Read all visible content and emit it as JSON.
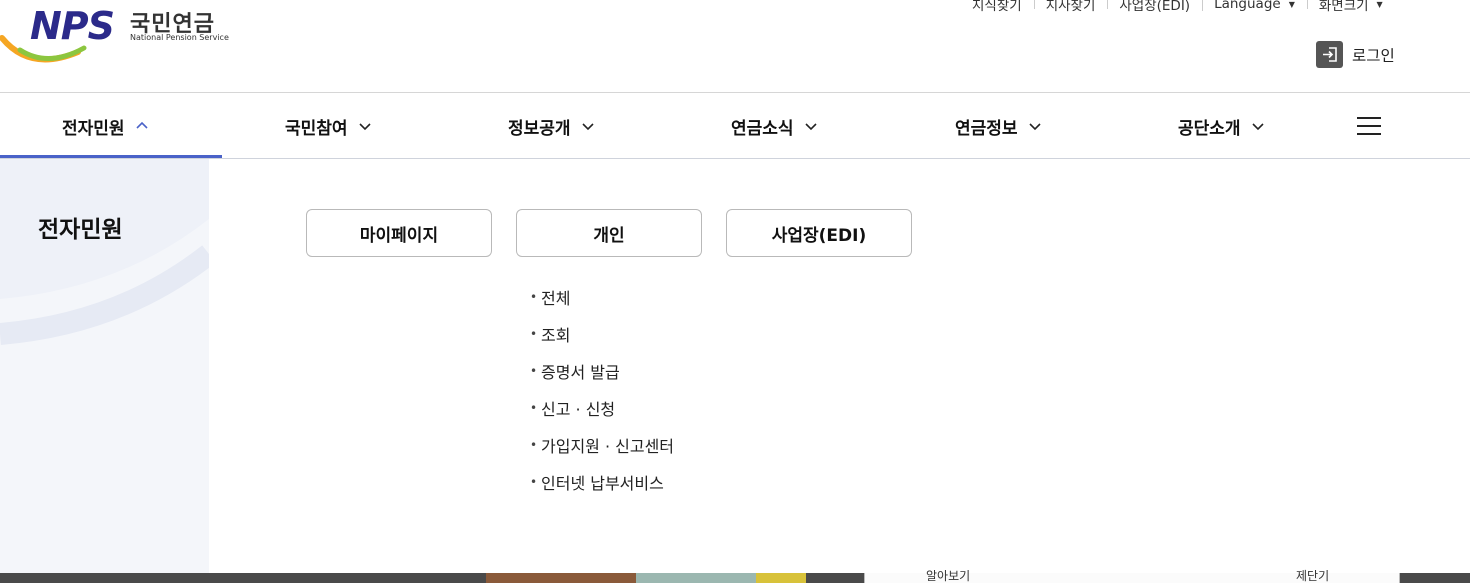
{
  "logo": {
    "mark": "NPS",
    "name_ko": "국민연금",
    "name_en": "National Pension Service"
  },
  "utility": [
    {
      "label": "지식찾기",
      "caret": false
    },
    {
      "label": "지사찾기",
      "caret": false
    },
    {
      "label": "사업장(EDI)",
      "caret": false
    },
    {
      "label": "Language",
      "caret": true
    },
    {
      "label": "화면크기",
      "caret": true
    }
  ],
  "login": {
    "label": "로그인",
    "icon": "login-icon"
  },
  "gnb": [
    {
      "label": "전자민원",
      "active": true
    },
    {
      "label": "국민참여",
      "active": false
    },
    {
      "label": "정보공개",
      "active": false
    },
    {
      "label": "연금소식",
      "active": false
    },
    {
      "label": "연금정보",
      "active": false
    },
    {
      "label": "공단소개",
      "active": false
    }
  ],
  "menu_icon": "hamburger-menu-icon",
  "panel": {
    "title": "전자민원",
    "categories": [
      "마이페이지",
      "개인",
      "사업장(EDI)"
    ],
    "submenu": [
      "전체",
      "조회",
      "증명서 발급",
      "신고 · 신청",
      "가입지원 · 신고센터",
      "인터넷 납부서비스"
    ]
  },
  "underlying": {
    "left_text": "알아보기",
    "right_text": "제단기"
  },
  "colors": {
    "brand_navy": "#2b2a8a",
    "active_bar": "#4a62c8",
    "side_bg": "#f4f6fa"
  }
}
